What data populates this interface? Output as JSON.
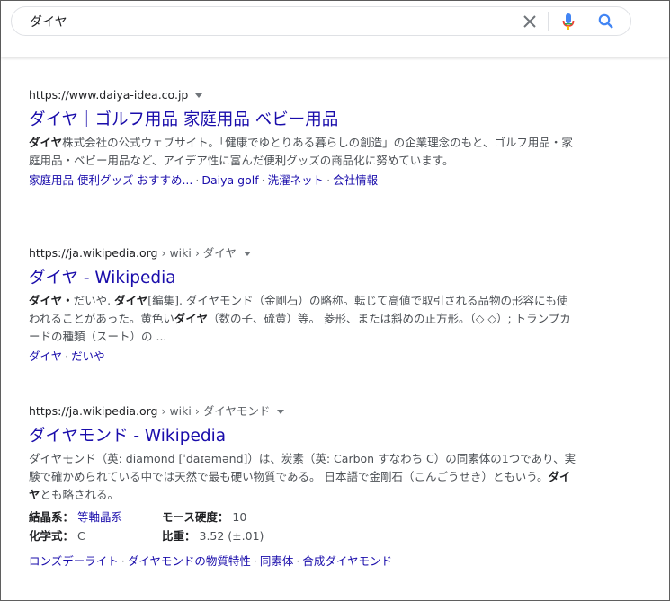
{
  "search": {
    "query": "ダイヤ"
  },
  "results": [
    {
      "cite": "https://www.daiya-idea.co.jp",
      "title": "ダイヤ｜ゴルフ用品 家庭用品 ベビー用品",
      "snippet_b1": "ダイヤ",
      "snippet_1": "株式会社の公式ウェブサイト。「健康でゆとりある暮らしの創造」の企業理念のもと、ゴルフ用品・家庭用品・ベビー用品など、アイデア性に富んだ便利グッズの商品化に努めています。",
      "sitelinks": [
        "家庭用品 便利グッズ おすすめ...",
        "Daiya golf",
        "洗濯ネット",
        "会社情報"
      ]
    },
    {
      "cite": "https://ja.wikipedia.org",
      "cite_crumb": " › wiki › ダイヤ",
      "title": "ダイヤ - Wikipedia",
      "snippet_b1": "ダイヤ・",
      "snippet_1": "だいや. ",
      "snippet_b2": "ダイヤ",
      "snippet_2": "[編集]. ダイヤモンド（金剛石）の略称。転じて高値で取引される品物の形容にも使われることがあった。黄色い",
      "snippet_b3": "ダイヤ",
      "snippet_3": "（数の子、硫黄）等。 菱形、または斜めの正方形。（◇ ◇）; トランプカードの種類（スート）の ...",
      "sitelinks": [
        "ダイヤ",
        "だいや"
      ]
    },
    {
      "cite": "https://ja.wikipedia.org",
      "cite_crumb": " › wiki › ダイヤモンド",
      "title": "ダイヤモンド - Wikipedia",
      "snippet_1": "ダイヤモンド（英: diamond [ˈdaɪəmənd]）は、炭素（英: Carbon すなわち C）の同素体の1つであり、実験で確かめられている中では天然で最も硬い物質である。 日本語で金剛石（こんごうせき）ともいう。",
      "snippet_b1": "ダイヤ",
      "snippet_2": "とも略される。",
      "facts": {
        "k1": "結晶系：",
        "v1": "等軸晶系",
        "k2": "モース硬度：",
        "v2": "10",
        "k3": "化学式：",
        "v3": "C",
        "k4": "比重：",
        "v4": "3.52 (±.01)"
      },
      "sitelinks": [
        "ロンズデーライト",
        "ダイヤモンドの物質特性",
        "同素体",
        "合成ダイヤモンド"
      ]
    }
  ]
}
